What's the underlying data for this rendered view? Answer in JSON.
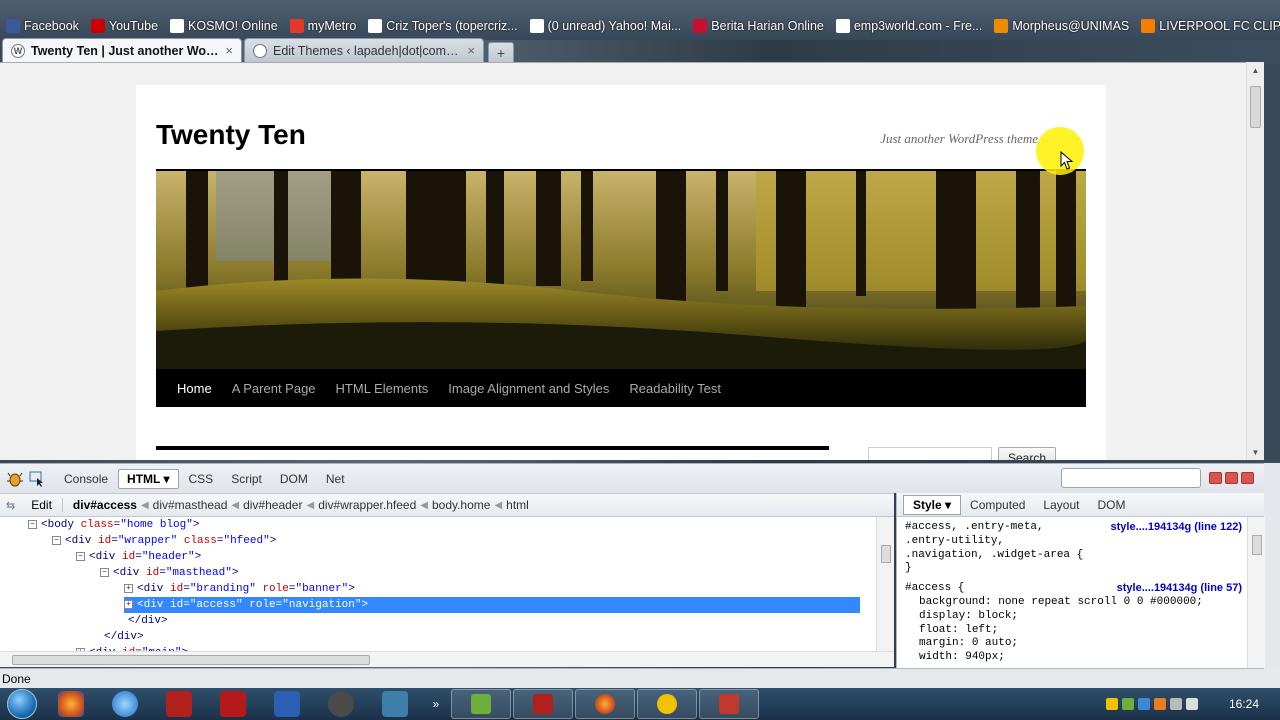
{
  "bookmarks": [
    {
      "label": "Facebook",
      "icon": "facebook-icon",
      "color": "#3b5998"
    },
    {
      "label": "YouTube",
      "icon": "youtube-icon",
      "color": "#cc0000"
    },
    {
      "label": "KOSMO! Online",
      "icon": "page-icon",
      "color": "#ffffff"
    },
    {
      "label": "myMetro",
      "icon": "mymetro-icon",
      "color": "#e23a2a"
    },
    {
      "label": "Criz Toper's (topercriz...",
      "icon": "page-icon",
      "color": "#ffffff"
    },
    {
      "label": "(0 unread) Yahoo! Mai...",
      "icon": "page-icon",
      "color": "#ffffff"
    },
    {
      "label": "Berita Harian Online",
      "icon": "bh-icon",
      "color": "#c8102e"
    },
    {
      "label": "emp3world.com - Fre...",
      "icon": "page-icon",
      "color": "#ffffff"
    },
    {
      "label": "Morpheus@UNIMAS",
      "icon": "morpheus-icon",
      "color": "#f08a00"
    },
    {
      "label": "LIVERPOOL FC CLIPS",
      "icon": "blogger-icon",
      "color": "#f57d00"
    }
  ],
  "bookmarks_more": "»",
  "tabs": [
    {
      "title": "Twenty Ten | Just another WordP...",
      "close": "×",
      "active": true
    },
    {
      "title": "Edit Themes ‹ lapadeh|dot|com blo...",
      "close": "×",
      "active": false
    }
  ],
  "new_tab": "+",
  "site": {
    "title": "Twenty Ten",
    "description": "Just another WordPress theme",
    "nav": [
      "Home",
      "A Parent Page",
      "HTML Elements",
      "Image Alignment and Styles",
      "Readability Test"
    ],
    "search_button": "Search"
  },
  "firebug": {
    "tabs": [
      "Console",
      "HTML ▾",
      "CSS",
      "Script",
      "DOM",
      "Net"
    ],
    "active_tab": "HTML ▾",
    "edit": "Edit",
    "breadcrumbs": [
      "div#access",
      "div#masthead",
      "div#header",
      "div#wrapper.hfeed",
      "body.home",
      "html"
    ],
    "tree": [
      {
        "indent": 28,
        "toggle": "⊟",
        "tag_open": "<body",
        "attrs": [
          {
            "n": "class",
            "v": "\"home blog\""
          }
        ],
        "tag_close": ">",
        "selected": false
      },
      {
        "indent": 52,
        "toggle": "⊟",
        "tag_open": "<div",
        "attrs": [
          {
            "n": "id",
            "v": "\"wrapper\""
          },
          {
            "n": "class",
            "v": "\"hfeed\""
          }
        ],
        "tag_close": ">",
        "selected": false
      },
      {
        "indent": 76,
        "toggle": "⊟",
        "tag_open": "<div",
        "attrs": [
          {
            "n": "id",
            "v": "\"header\""
          }
        ],
        "tag_close": ">",
        "selected": false
      },
      {
        "indent": 100,
        "toggle": "⊟",
        "tag_open": "<div",
        "attrs": [
          {
            "n": "id",
            "v": "\"masthead\""
          }
        ],
        "tag_close": ">",
        "selected": false
      },
      {
        "indent": 124,
        "toggle": "⊞",
        "tag_open": "<div",
        "attrs": [
          {
            "n": "id",
            "v": "\"branding\""
          },
          {
            "n": "role",
            "v": "\"banner\""
          }
        ],
        "tag_close": ">",
        "selected": false
      },
      {
        "indent": 124,
        "toggle": "⊞",
        "tag_open": "<div",
        "attrs": [
          {
            "n": "id",
            "v": "\"access\""
          },
          {
            "n": "role",
            "v": "\"navigation\""
          }
        ],
        "tag_close": ">",
        "selected": true
      },
      {
        "indent": 114,
        "toggle": "",
        "tag_open": "</div>",
        "attrs": [],
        "tag_close": "",
        "selected": false
      },
      {
        "indent": 90,
        "toggle": "",
        "tag_open": "</div>",
        "attrs": [],
        "tag_close": "",
        "selected": false
      },
      {
        "indent": 76,
        "toggle": "⊞",
        "tag_open": "<div",
        "attrs": [
          {
            "n": "id",
            "v": "\"main\""
          }
        ],
        "tag_close": ">",
        "selected": false
      }
    ],
    "side_tabs": [
      "Style ▾",
      "Computed",
      "Layout",
      "DOM"
    ],
    "side_active": "Style ▾",
    "css_rules": [
      {
        "selector_lines": [
          "#access, .entry-meta,",
          ".entry-utility,",
          ".navigation, .widget-area {"
        ],
        "source": "style....194134g (line 122)",
        "props": [],
        "close": "}"
      },
      {
        "selector_lines": [
          "#access {"
        ],
        "source": "style....194134g (line 57)",
        "props": [
          {
            "n": "background:",
            "v": "none repeat scroll 0 0 #000000;"
          },
          {
            "n": "display:",
            "v": "block;"
          },
          {
            "n": "float:",
            "v": "left;"
          },
          {
            "n": "margin:",
            "v": "0 auto;"
          },
          {
            "n": "width:",
            "v": "940px;"
          }
        ],
        "close": ""
      }
    ]
  },
  "status": "Done",
  "clock": "16:24",
  "colors": {
    "selection": "#3388ff",
    "nav_bg": "#000000",
    "link": "#0000cc"
  }
}
